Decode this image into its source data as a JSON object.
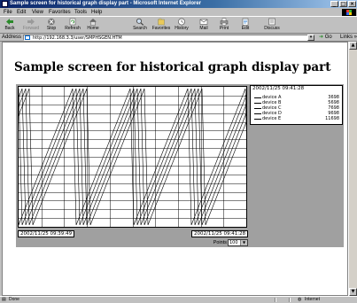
{
  "window": {
    "title": "Sample screen for historical graph display part - Microsoft Internet Explorer",
    "minimize": "_",
    "maximize": "□",
    "close": "×"
  },
  "menu": [
    "File",
    "Edit",
    "View",
    "Favorites",
    "Tools",
    "Help"
  ],
  "toolbar": [
    {
      "label": "Back",
      "icon": "back-arrow-icon",
      "enabled": true
    },
    {
      "label": "Forward",
      "icon": "forward-arrow-icon",
      "enabled": false
    },
    {
      "label": "Stop",
      "icon": "stop-icon",
      "enabled": true
    },
    {
      "label": "Refresh",
      "icon": "refresh-icon",
      "enabled": true
    },
    {
      "label": "Home",
      "icon": "home-icon",
      "enabled": true
    },
    {
      "label": "Search",
      "icon": "search-icon",
      "enabled": true
    },
    {
      "label": "Favorites",
      "icon": "favorites-icon",
      "enabled": true
    },
    {
      "label": "History",
      "icon": "history-icon",
      "enabled": true
    },
    {
      "label": "Mail",
      "icon": "mail-icon",
      "enabled": true
    },
    {
      "label": "Print",
      "icon": "print-icon",
      "enabled": true
    },
    {
      "label": "Edit",
      "icon": "edit-icon",
      "enabled": true
    },
    {
      "label": "Discuss",
      "icon": "discuss-icon",
      "enabled": true
    }
  ],
  "address": {
    "label": "Address",
    "url": "http://192.168.3.3/user/SMPHSGEN.HTM",
    "go": "Go",
    "links": "Links »"
  },
  "page": {
    "heading": "Sample screen for historical graph display part"
  },
  "graph": {
    "current_time": "2002/11/25 09:41:28",
    "start_time": "2002/11/25 09:39:49",
    "end_time": "2002/11/25 09:41:28",
    "points_label": "Points",
    "points_value": "100",
    "legend": [
      {
        "name": "device A",
        "value": "3698"
      },
      {
        "name": "device B",
        "value": "5698"
      },
      {
        "name": "device C",
        "value": "7698"
      },
      {
        "name": "device D",
        "value": "9698"
      },
      {
        "name": "device E",
        "value": "11698"
      }
    ]
  },
  "status": {
    "left": "Done",
    "zone": "Internet"
  }
}
